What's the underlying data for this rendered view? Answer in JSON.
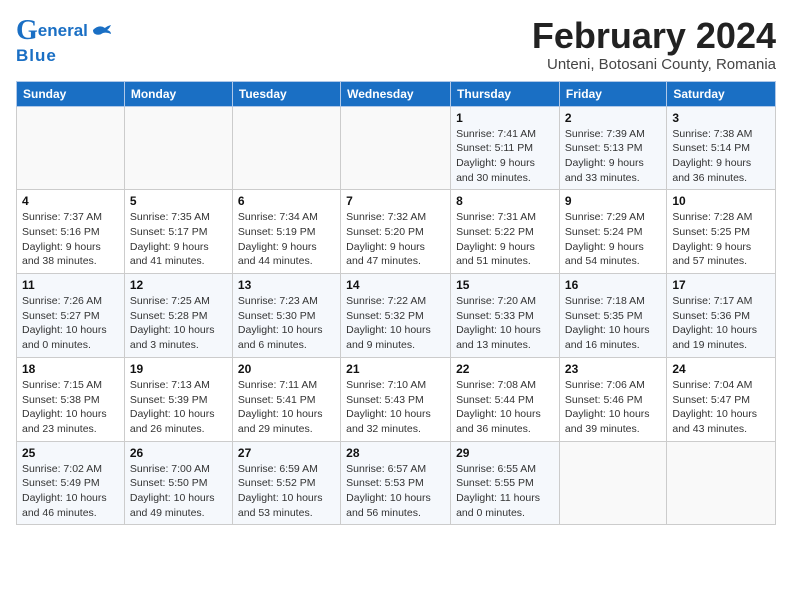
{
  "header": {
    "logo_general": "General",
    "logo_blue": "Blue",
    "main_title": "February 2024",
    "subtitle": "Unteni, Botosani County, Romania"
  },
  "calendar": {
    "days_of_week": [
      "Sunday",
      "Monday",
      "Tuesday",
      "Wednesday",
      "Thursday",
      "Friday",
      "Saturday"
    ],
    "weeks": [
      [
        {
          "day": "",
          "info": ""
        },
        {
          "day": "",
          "info": ""
        },
        {
          "day": "",
          "info": ""
        },
        {
          "day": "",
          "info": ""
        },
        {
          "day": "1",
          "info": "Sunrise: 7:41 AM\nSunset: 5:11 PM\nDaylight: 9 hours and 30 minutes."
        },
        {
          "day": "2",
          "info": "Sunrise: 7:39 AM\nSunset: 5:13 PM\nDaylight: 9 hours and 33 minutes."
        },
        {
          "day": "3",
          "info": "Sunrise: 7:38 AM\nSunset: 5:14 PM\nDaylight: 9 hours and 36 minutes."
        }
      ],
      [
        {
          "day": "4",
          "info": "Sunrise: 7:37 AM\nSunset: 5:16 PM\nDaylight: 9 hours and 38 minutes."
        },
        {
          "day": "5",
          "info": "Sunrise: 7:35 AM\nSunset: 5:17 PM\nDaylight: 9 hours and 41 minutes."
        },
        {
          "day": "6",
          "info": "Sunrise: 7:34 AM\nSunset: 5:19 PM\nDaylight: 9 hours and 44 minutes."
        },
        {
          "day": "7",
          "info": "Sunrise: 7:32 AM\nSunset: 5:20 PM\nDaylight: 9 hours and 47 minutes."
        },
        {
          "day": "8",
          "info": "Sunrise: 7:31 AM\nSunset: 5:22 PM\nDaylight: 9 hours and 51 minutes."
        },
        {
          "day": "9",
          "info": "Sunrise: 7:29 AM\nSunset: 5:24 PM\nDaylight: 9 hours and 54 minutes."
        },
        {
          "day": "10",
          "info": "Sunrise: 7:28 AM\nSunset: 5:25 PM\nDaylight: 9 hours and 57 minutes."
        }
      ],
      [
        {
          "day": "11",
          "info": "Sunrise: 7:26 AM\nSunset: 5:27 PM\nDaylight: 10 hours and 0 minutes."
        },
        {
          "day": "12",
          "info": "Sunrise: 7:25 AM\nSunset: 5:28 PM\nDaylight: 10 hours and 3 minutes."
        },
        {
          "day": "13",
          "info": "Sunrise: 7:23 AM\nSunset: 5:30 PM\nDaylight: 10 hours and 6 minutes."
        },
        {
          "day": "14",
          "info": "Sunrise: 7:22 AM\nSunset: 5:32 PM\nDaylight: 10 hours and 9 minutes."
        },
        {
          "day": "15",
          "info": "Sunrise: 7:20 AM\nSunset: 5:33 PM\nDaylight: 10 hours and 13 minutes."
        },
        {
          "day": "16",
          "info": "Sunrise: 7:18 AM\nSunset: 5:35 PM\nDaylight: 10 hours and 16 minutes."
        },
        {
          "day": "17",
          "info": "Sunrise: 7:17 AM\nSunset: 5:36 PM\nDaylight: 10 hours and 19 minutes."
        }
      ],
      [
        {
          "day": "18",
          "info": "Sunrise: 7:15 AM\nSunset: 5:38 PM\nDaylight: 10 hours and 23 minutes."
        },
        {
          "day": "19",
          "info": "Sunrise: 7:13 AM\nSunset: 5:39 PM\nDaylight: 10 hours and 26 minutes."
        },
        {
          "day": "20",
          "info": "Sunrise: 7:11 AM\nSunset: 5:41 PM\nDaylight: 10 hours and 29 minutes."
        },
        {
          "day": "21",
          "info": "Sunrise: 7:10 AM\nSunset: 5:43 PM\nDaylight: 10 hours and 32 minutes."
        },
        {
          "day": "22",
          "info": "Sunrise: 7:08 AM\nSunset: 5:44 PM\nDaylight: 10 hours and 36 minutes."
        },
        {
          "day": "23",
          "info": "Sunrise: 7:06 AM\nSunset: 5:46 PM\nDaylight: 10 hours and 39 minutes."
        },
        {
          "day": "24",
          "info": "Sunrise: 7:04 AM\nSunset: 5:47 PM\nDaylight: 10 hours and 43 minutes."
        }
      ],
      [
        {
          "day": "25",
          "info": "Sunrise: 7:02 AM\nSunset: 5:49 PM\nDaylight: 10 hours and 46 minutes."
        },
        {
          "day": "26",
          "info": "Sunrise: 7:00 AM\nSunset: 5:50 PM\nDaylight: 10 hours and 49 minutes."
        },
        {
          "day": "27",
          "info": "Sunrise: 6:59 AM\nSunset: 5:52 PM\nDaylight: 10 hours and 53 minutes."
        },
        {
          "day": "28",
          "info": "Sunrise: 6:57 AM\nSunset: 5:53 PM\nDaylight: 10 hours and 56 minutes."
        },
        {
          "day": "29",
          "info": "Sunrise: 6:55 AM\nSunset: 5:55 PM\nDaylight: 11 hours and 0 minutes."
        },
        {
          "day": "",
          "info": ""
        },
        {
          "day": "",
          "info": ""
        }
      ]
    ]
  }
}
